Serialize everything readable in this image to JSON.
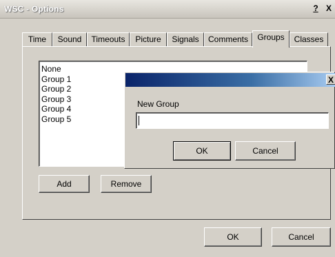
{
  "window": {
    "title": "WSC - Options",
    "help_label": "?",
    "close_label": "X"
  },
  "tabs": [
    {
      "label": "Time"
    },
    {
      "label": "Sound"
    },
    {
      "label": "Timeouts"
    },
    {
      "label": "Picture"
    },
    {
      "label": "Signals"
    },
    {
      "label": "Comments"
    },
    {
      "label": "Groups",
      "active": true
    },
    {
      "label": "Classes"
    }
  ],
  "groups_list": {
    "items": [
      "None",
      "Group 1",
      "Group 2",
      "Group 3",
      "Group 4",
      "Group 5"
    ]
  },
  "groups_panel": {
    "add_label": "Add",
    "remove_label": "Remove"
  },
  "dialog": {
    "title": "",
    "close_label": "X",
    "field_label": "New Group",
    "field_value": "",
    "ok_label": "OK",
    "cancel_label": "Cancel"
  },
  "footer": {
    "ok_label": "OK",
    "cancel_label": "Cancel"
  }
}
